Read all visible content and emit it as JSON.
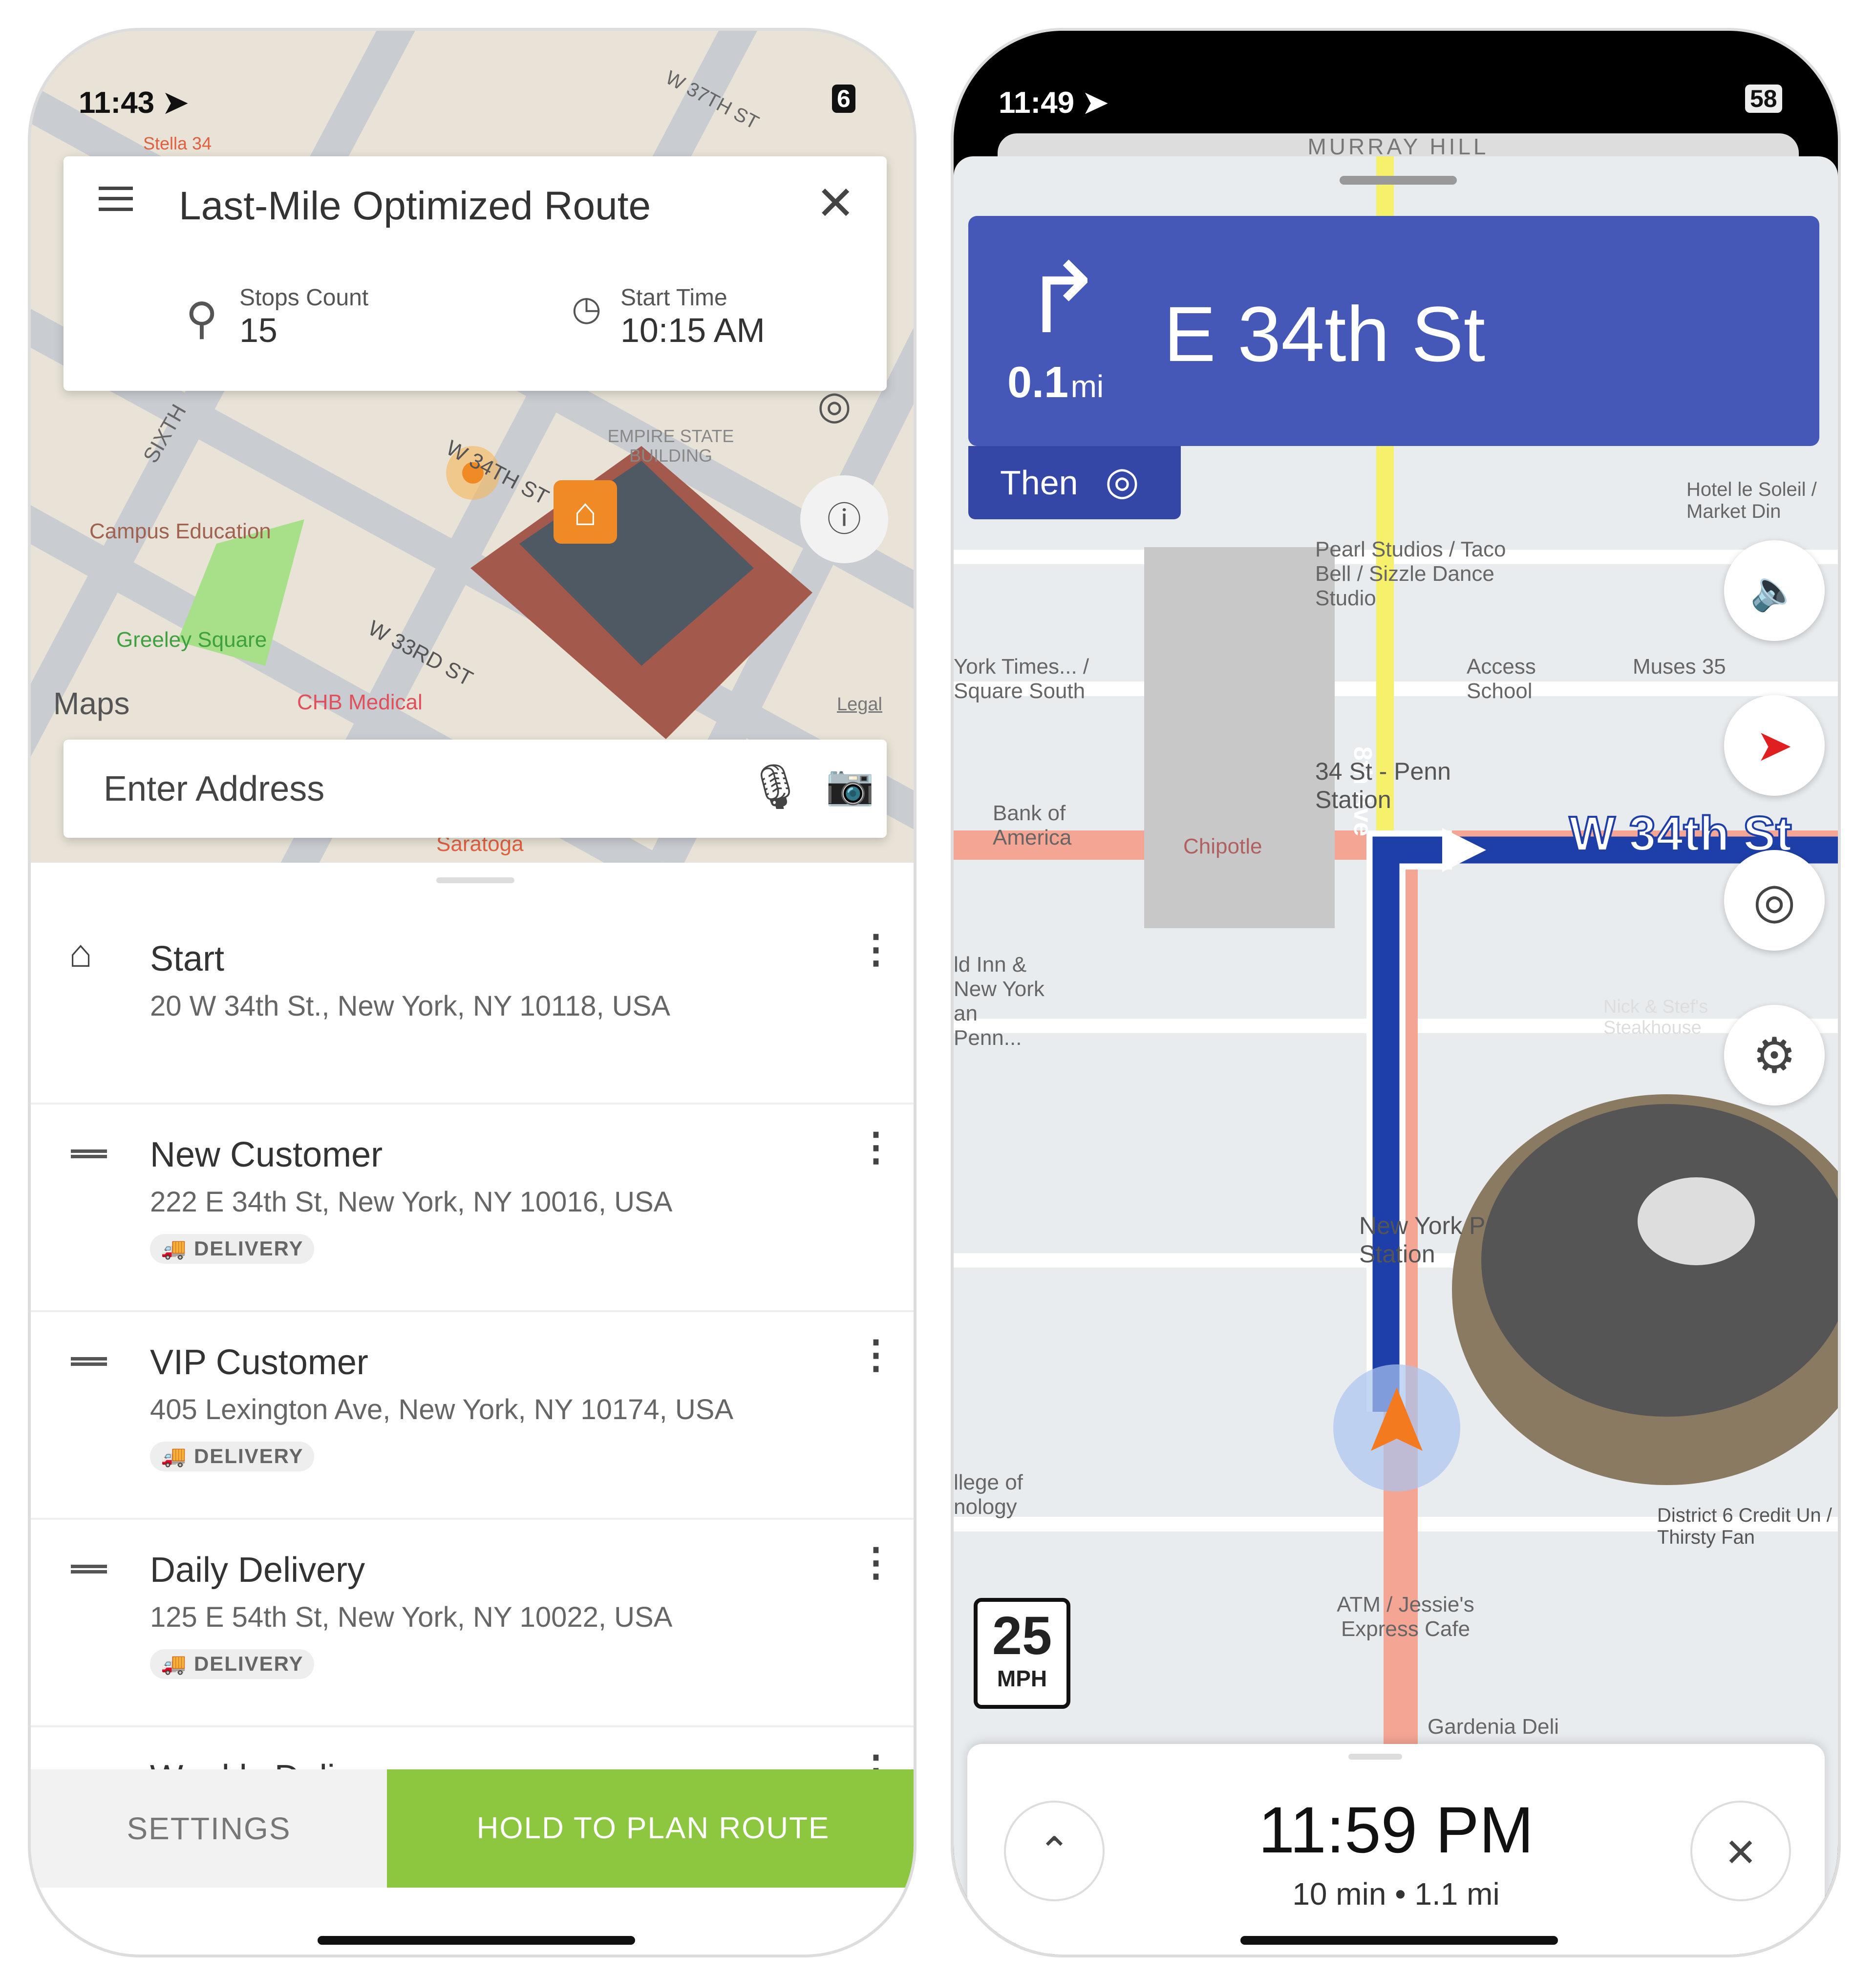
{
  "left_phone": {
    "status": {
      "time": "11:43",
      "battery": "6"
    },
    "header": {
      "title": "Last-Mile Optimized Route",
      "stops_label": "Stops Count",
      "stops_value": "15",
      "start_label": "Start Time",
      "start_value": "10:15 AM"
    },
    "map_labels": {
      "street1": "W 37TH ST",
      "street2": "SIXTH",
      "street3": "W 34TH ST",
      "street4": "W 33RD ST",
      "poi1": "Campus Education",
      "poi2": "Greeley Square",
      "poi3": "CHB Medical",
      "poi4": "EMPIRE STATE BUILDING",
      "poi5": "Saratoga",
      "poi6": "Stella 34",
      "maps_logo": "Maps",
      "legal": "Legal"
    },
    "search": {
      "placeholder": "Enter Address"
    },
    "stops": [
      {
        "title": "Start",
        "address": "20 W 34th St., New York, NY 10118, USA",
        "icon": "home-icon"
      },
      {
        "title": "New Customer",
        "address": "222 E 34th St, New York, NY 10016, USA",
        "badge": "DELIVERY"
      },
      {
        "title": "VIP Customer",
        "address": "405 Lexington Ave, New York, NY 10174, USA",
        "badge": "DELIVERY"
      },
      {
        "title": "Daily Delivery",
        "address": "125 E 54th St, New York, NY 10022, USA",
        "badge": "DELIVERY"
      },
      {
        "title": "Weekly Delivery"
      }
    ],
    "footer": {
      "settings": "SETTINGS",
      "plan": "HOLD TO PLAN ROUTE"
    },
    "colors": {
      "accent": "#8dc63f",
      "marker": "#f08a24"
    }
  },
  "right_phone": {
    "status": {
      "time": "11:49",
      "battery": "58"
    },
    "maneuver": {
      "distance": "0.1",
      "unit": "mi",
      "street": "E 34th St",
      "then": "Then",
      "icon": "turn-right-icon"
    },
    "map_labels": {
      "a": "MURRAY HILL",
      "b": "Pearl Studios / Taco Bell / Sizzle Dance Studio",
      "c": "York Times... / Square South",
      "d": "Access School",
      "e": "Muses 35",
      "f": "34 St - Penn Station",
      "g": "Bank of America",
      "h": "Chipotle",
      "i": "W 34th St",
      "j": "8th Ave",
      "k": "New York Penn Station",
      "l": "Penn Stat",
      "m": "Hotel le Soleil / Market Din",
      "n": "Nick & Stef's Steakhouse",
      "o": "llege of nology",
      "p": "ATM / Jessie's Express Cafe",
      "q": "Gardenia Deli",
      "r": "District 6 Credit Un / Thirsty Fan",
      "s": "ld Inn & New York an Penn..."
    },
    "speed_limit": {
      "value": "25",
      "unit": "MPH"
    },
    "eta": {
      "time": "11:59 PM",
      "summary": "10 min • 1.1 mi"
    },
    "colors": {
      "banner": "#4558b8",
      "banner_dark": "#3446a6",
      "route": "#1e3fa8",
      "puck": "#f47a20"
    }
  }
}
